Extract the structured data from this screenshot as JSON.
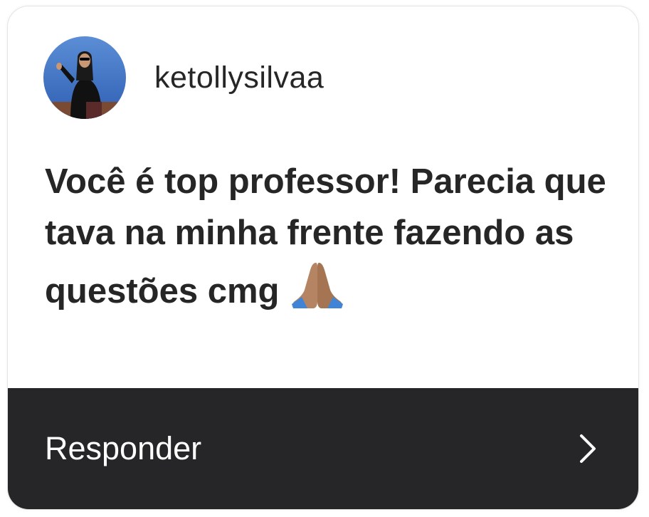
{
  "comment": {
    "username": "ketollysilvaa",
    "avatar_icon": "profile-photo",
    "message_text": "Você é top professor! Parecia que tava na minha frente fazendo as questões cmg",
    "message_emoji": "🙏",
    "emoji_icon": "folded-hands-icon"
  },
  "reply_bar": {
    "label": "Responder",
    "icon": "chevron-right-icon",
    "background": "#262628"
  }
}
